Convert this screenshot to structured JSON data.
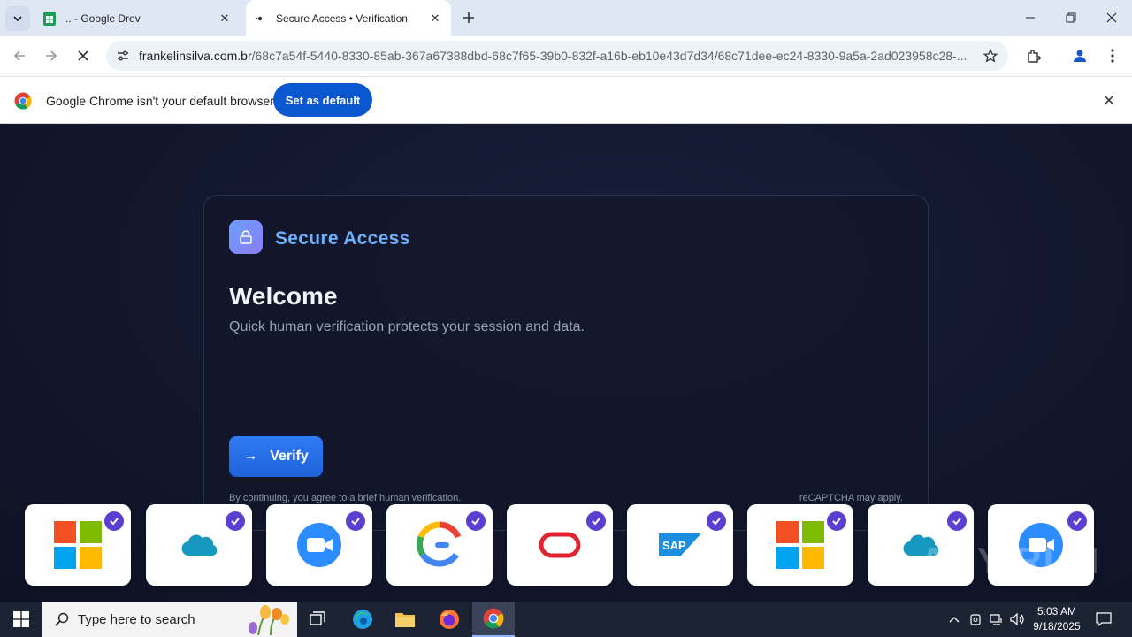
{
  "browser": {
    "tabs": [
      {
        "title": ".. - Google Drev",
        "active": false,
        "favicon": "google-sheets-icon"
      },
      {
        "title": "Secure Access • Verification",
        "active": true,
        "favicon": "loading-icon"
      }
    ],
    "address": {
      "host": "frankelinsilva.com.br",
      "path": "/68c7a54f-5440-8330-85ab-367a67388dbd-68c7f65-39b0-832f-a16b-eb10e43d7d34/68c71dee-ec24-8330-9a5a-2ad023958c28-..."
    },
    "infobar": {
      "message": "Google Chrome isn't your default browser",
      "button": "Set as default"
    }
  },
  "page": {
    "brand": "Secure Access",
    "heading": "Welcome",
    "subtitle": "Quick human verification protects your session and data.",
    "verify_button": "Verify",
    "verify_arrow": "→",
    "footnote": "By continuing, you agree to a brief human verification.",
    "recaptcha": "reCAPTCHA may apply.",
    "logos": [
      "microsoft",
      "salesforce",
      "zoom",
      "google",
      "oracle",
      "sap",
      "microsoft",
      "salesforce",
      "zoom"
    ],
    "sap_text": "SAP",
    "watermark": "ANY RUN"
  },
  "taskbar": {
    "search_placeholder": "Type here to search",
    "time": "5:03 AM",
    "date": "9/18/2025"
  },
  "colors": {
    "accent_blue": "#0b57d0",
    "brand_text": "#6fb0ff",
    "check_purple": "#5b3fd1",
    "page_bg": "#131830"
  }
}
